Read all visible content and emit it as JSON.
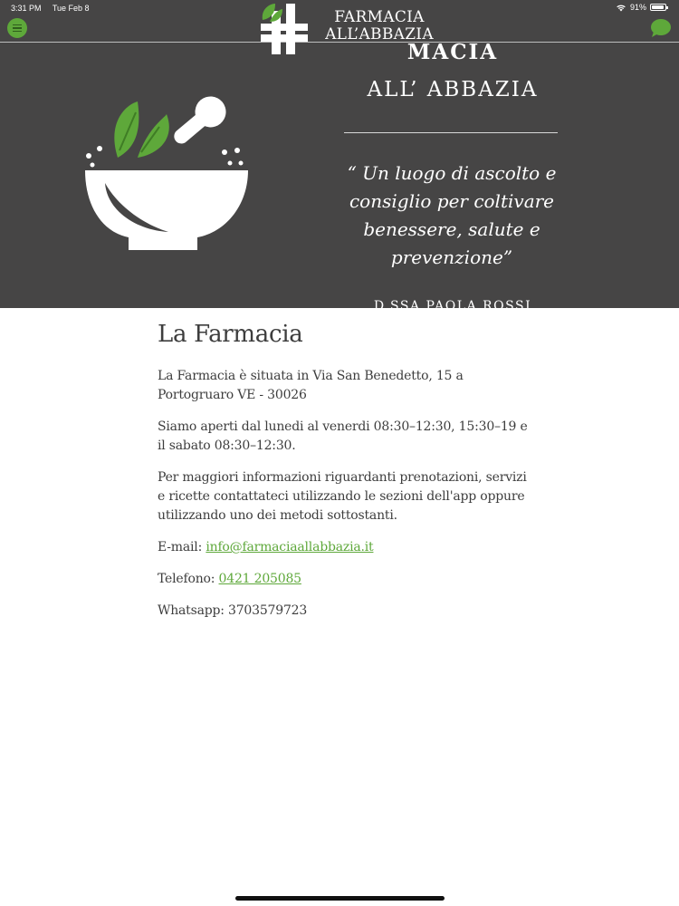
{
  "status_bar": {
    "time": "3:31 PM",
    "date": "Tue Feb 8",
    "battery": "91%",
    "battery_level": 0.91
  },
  "header": {
    "brand_line_1": "FARMACIA",
    "brand_line_2": "ALL’ABBAZIA",
    "menu_icon": "menu-icon",
    "chat_icon": "chat-bubble-icon"
  },
  "hero": {
    "title_line_1": "MACIA",
    "title_line_2": "ALL’ ABBAZIA",
    "quote": "“ Un luogo di ascolto e consiglio per coltivare benessere, salute e prevenzione”",
    "signature": "D.SSA PAOLA ROSSI"
  },
  "content": {
    "title": "La Farmacia",
    "address": "La Farmacia è situata in Via San Benedetto, 15 a Portogruaro VE - 30026",
    "hours": "Siamo aperti dal lunedi al venerdi 08:30–12:30, 15:30–19 e il sabato 08:30–12:30.",
    "info": "Per maggiori informazioni riguardanti prenotazioni, servizi e ricette contattateci utilizzando le sezioni dell'app oppure utilizzando uno dei metodi sottostanti.",
    "email_label": "E-mail:",
    "email": "info@farmaciaallabbazia.it",
    "phone_label": "Telefono:",
    "phone": "0421 205085",
    "whatsapp_label": "Whatsapp:",
    "whatsapp": "3703579723"
  },
  "colors": {
    "accent": "#5ea83a",
    "hero_bg": "#464545",
    "text": "#3d3d3d"
  }
}
